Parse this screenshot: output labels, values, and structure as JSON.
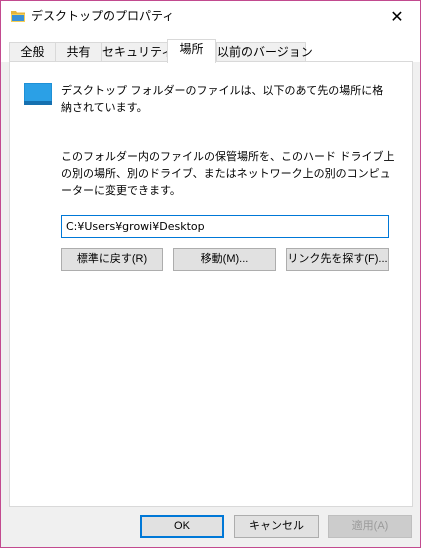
{
  "window": {
    "title": "デスクトップのプロパティ"
  },
  "tabs": [
    {
      "label": "全般"
    },
    {
      "label": "共有"
    },
    {
      "label": "セキュリティ"
    },
    {
      "label": "場所"
    },
    {
      "label": "以前のバージョン"
    }
  ],
  "location": {
    "description": "デスクトップ フォルダーのファイルは、以下のあて先の場所に格納されています。",
    "instructions": "このフォルダー内のファイルの保管場所を、このハード ドライブ上の別の場所、別のドライブ、またはネットワーク上の別のコンピューターに変更できます。",
    "path_value": "C:¥Users¥growi¥Desktop",
    "restore_label": "標準に戻す(R)",
    "move_label": "移動(M)...",
    "find_target_label": "リンク先を探す(F)..."
  },
  "footer": {
    "ok_label": "OK",
    "cancel_label": "キャンセル",
    "apply_label": "適用(A)"
  },
  "colors": {
    "accent": "#0078d7",
    "folder_blue": "#1e90d6",
    "window_border": "#c24a8f"
  }
}
